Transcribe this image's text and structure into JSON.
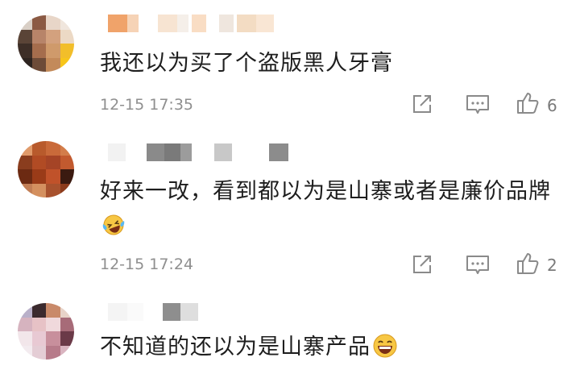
{
  "comments": [
    {
      "text": "我还以为买了个盗版黑人牙膏",
      "time": "12-15 17:35",
      "likes": "6"
    },
    {
      "text": "好来一改，看到都以为是山寨或者是廉价品牌",
      "time": "12-15 17:24",
      "likes": "2"
    },
    {
      "text": "不知道的还以为是山寨产品"
    }
  ],
  "colors": {
    "text": "#1e1e1e",
    "meta": "#8f8f8f",
    "icon": "#8a8a8a",
    "background": "#ffffff"
  },
  "icons": [
    "share-icon",
    "comment-icon",
    "like-icon",
    "laughing-crying-emoji-icon",
    "grinning-emoji-icon"
  ]
}
